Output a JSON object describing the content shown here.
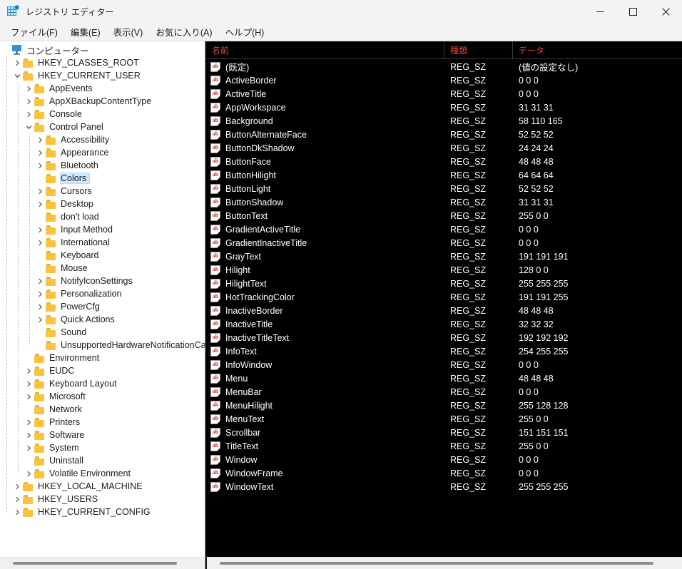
{
  "window": {
    "title": "レジストリ エディター",
    "app_icon": "registry-editor-icon",
    "controls": {
      "minimize": "minimize-icon",
      "maximize": "maximize-icon",
      "close": "close-icon"
    }
  },
  "menubar": {
    "items": [
      {
        "label": "ファイル(F)"
      },
      {
        "label": "編集(E)"
      },
      {
        "label": "表示(V)"
      },
      {
        "label": "お気に入り(A)"
      },
      {
        "label": "ヘルプ(H)"
      }
    ]
  },
  "tree": {
    "nodes": [
      {
        "label": "コンピューター",
        "depth": 0,
        "icon": "computer-icon",
        "expander": "none",
        "selected": false
      },
      {
        "label": "HKEY_CLASSES_ROOT",
        "depth": 1,
        "icon": "folder-icon",
        "expander": "collapsed",
        "selected": false
      },
      {
        "label": "HKEY_CURRENT_USER",
        "depth": 1,
        "icon": "folder-icon",
        "expander": "expanded",
        "selected": false
      },
      {
        "label": "AppEvents",
        "depth": 2,
        "icon": "folder-icon",
        "expander": "collapsed",
        "selected": false
      },
      {
        "label": "AppXBackupContentType",
        "depth": 2,
        "icon": "folder-icon",
        "expander": "collapsed",
        "selected": false
      },
      {
        "label": "Console",
        "depth": 2,
        "icon": "folder-icon",
        "expander": "collapsed",
        "selected": false
      },
      {
        "label": "Control Panel",
        "depth": 2,
        "icon": "folder-icon",
        "expander": "expanded",
        "selected": false
      },
      {
        "label": "Accessibility",
        "depth": 3,
        "icon": "folder-icon",
        "expander": "collapsed",
        "selected": false
      },
      {
        "label": "Appearance",
        "depth": 3,
        "icon": "folder-icon",
        "expander": "collapsed",
        "selected": false
      },
      {
        "label": "Bluetooth",
        "depth": 3,
        "icon": "folder-icon",
        "expander": "collapsed",
        "selected": false
      },
      {
        "label": "Colors",
        "depth": 3,
        "icon": "folder-icon",
        "expander": "none",
        "selected": true
      },
      {
        "label": "Cursors",
        "depth": 3,
        "icon": "folder-icon",
        "expander": "collapsed",
        "selected": false
      },
      {
        "label": "Desktop",
        "depth": 3,
        "icon": "folder-icon",
        "expander": "collapsed",
        "selected": false
      },
      {
        "label": "don't load",
        "depth": 3,
        "icon": "folder-icon",
        "expander": "none",
        "selected": false
      },
      {
        "label": "Input Method",
        "depth": 3,
        "icon": "folder-icon",
        "expander": "collapsed",
        "selected": false
      },
      {
        "label": "International",
        "depth": 3,
        "icon": "folder-icon",
        "expander": "collapsed",
        "selected": false
      },
      {
        "label": "Keyboard",
        "depth": 3,
        "icon": "folder-icon",
        "expander": "none",
        "selected": false
      },
      {
        "label": "Mouse",
        "depth": 3,
        "icon": "folder-icon",
        "expander": "none",
        "selected": false
      },
      {
        "label": "NotifyIconSettings",
        "depth": 3,
        "icon": "folder-icon",
        "expander": "collapsed",
        "selected": false
      },
      {
        "label": "Personalization",
        "depth": 3,
        "icon": "folder-icon",
        "expander": "collapsed",
        "selected": false
      },
      {
        "label": "PowerCfg",
        "depth": 3,
        "icon": "folder-icon",
        "expander": "collapsed",
        "selected": false
      },
      {
        "label": "Quick Actions",
        "depth": 3,
        "icon": "folder-icon",
        "expander": "collapsed",
        "selected": false
      },
      {
        "label": "Sound",
        "depth": 3,
        "icon": "folder-icon",
        "expander": "none",
        "selected": false
      },
      {
        "label": "UnsupportedHardwareNotificationCache",
        "depth": 3,
        "icon": "folder-icon",
        "expander": "none",
        "selected": false
      },
      {
        "label": "Environment",
        "depth": 2,
        "icon": "folder-icon",
        "expander": "none",
        "selected": false
      },
      {
        "label": "EUDC",
        "depth": 2,
        "icon": "folder-icon",
        "expander": "collapsed",
        "selected": false
      },
      {
        "label": "Keyboard Layout",
        "depth": 2,
        "icon": "folder-icon",
        "expander": "collapsed",
        "selected": false
      },
      {
        "label": "Microsoft",
        "depth": 2,
        "icon": "folder-icon",
        "expander": "collapsed",
        "selected": false
      },
      {
        "label": "Network",
        "depth": 2,
        "icon": "folder-icon",
        "expander": "none",
        "selected": false
      },
      {
        "label": "Printers",
        "depth": 2,
        "icon": "folder-icon",
        "expander": "collapsed",
        "selected": false
      },
      {
        "label": "Software",
        "depth": 2,
        "icon": "folder-icon",
        "expander": "collapsed",
        "selected": false
      },
      {
        "label": "System",
        "depth": 2,
        "icon": "folder-icon",
        "expander": "collapsed",
        "selected": false
      },
      {
        "label": "Uninstall",
        "depth": 2,
        "icon": "folder-icon",
        "expander": "none",
        "selected": false
      },
      {
        "label": "Volatile Environment",
        "depth": 2,
        "icon": "folder-icon",
        "expander": "collapsed",
        "selected": false
      },
      {
        "label": "HKEY_LOCAL_MACHINE",
        "depth": 1,
        "icon": "folder-icon",
        "expander": "collapsed",
        "selected": false
      },
      {
        "label": "HKEY_USERS",
        "depth": 1,
        "icon": "folder-icon",
        "expander": "collapsed",
        "selected": false
      },
      {
        "label": "HKEY_CURRENT_CONFIG",
        "depth": 1,
        "icon": "folder-icon",
        "expander": "collapsed",
        "selected": false
      }
    ]
  },
  "list": {
    "columns": [
      {
        "label": "名前"
      },
      {
        "label": "種類"
      },
      {
        "label": "データ"
      }
    ],
    "rows": [
      {
        "name": "(既定)",
        "type": "REG_SZ",
        "data": "(値の設定なし)"
      },
      {
        "name": "ActiveBorder",
        "type": "REG_SZ",
        "data": "0 0 0"
      },
      {
        "name": "ActiveTitle",
        "type": "REG_SZ",
        "data": "0 0 0"
      },
      {
        "name": "AppWorkspace",
        "type": "REG_SZ",
        "data": "31 31 31"
      },
      {
        "name": "Background",
        "type": "REG_SZ",
        "data": "58 110 165"
      },
      {
        "name": "ButtonAlternateFace",
        "type": "REG_SZ",
        "data": "52 52 52"
      },
      {
        "name": "ButtonDkShadow",
        "type": "REG_SZ",
        "data": "24 24 24"
      },
      {
        "name": "ButtonFace",
        "type": "REG_SZ",
        "data": "48 48 48"
      },
      {
        "name": "ButtonHilight",
        "type": "REG_SZ",
        "data": "64 64 64"
      },
      {
        "name": "ButtonLight",
        "type": "REG_SZ",
        "data": "52 52 52"
      },
      {
        "name": "ButtonShadow",
        "type": "REG_SZ",
        "data": "31 31 31"
      },
      {
        "name": "ButtonText",
        "type": "REG_SZ",
        "data": "255 0 0"
      },
      {
        "name": "GradientActiveTitle",
        "type": "REG_SZ",
        "data": "0 0 0"
      },
      {
        "name": "GradientInactiveTitle",
        "type": "REG_SZ",
        "data": "0 0 0"
      },
      {
        "name": "GrayText",
        "type": "REG_SZ",
        "data": "191 191 191"
      },
      {
        "name": "Hilight",
        "type": "REG_SZ",
        "data": "128 0 0"
      },
      {
        "name": "HilightText",
        "type": "REG_SZ",
        "data": "255 255 255"
      },
      {
        "name": "HotTrackingColor",
        "type": "REG_SZ",
        "data": "191 191 255"
      },
      {
        "name": "InactiveBorder",
        "type": "REG_SZ",
        "data": "48 48 48"
      },
      {
        "name": "InactiveTitle",
        "type": "REG_SZ",
        "data": "32 32 32"
      },
      {
        "name": "InactiveTitleText",
        "type": "REG_SZ",
        "data": "192 192 192"
      },
      {
        "name": "InfoText",
        "type": "REG_SZ",
        "data": "254 255 255"
      },
      {
        "name": "InfoWindow",
        "type": "REG_SZ",
        "data": "0 0 0"
      },
      {
        "name": "Menu",
        "type": "REG_SZ",
        "data": "48 48 48"
      },
      {
        "name": "MenuBar",
        "type": "REG_SZ",
        "data": "0 0 0"
      },
      {
        "name": "MenuHilight",
        "type": "REG_SZ",
        "data": "255 128 128"
      },
      {
        "name": "MenuText",
        "type": "REG_SZ",
        "data": "255 0 0"
      },
      {
        "name": "Scrollbar",
        "type": "REG_SZ",
        "data": "151 151 151"
      },
      {
        "name": "TitleText",
        "type": "REG_SZ",
        "data": "255 0 0"
      },
      {
        "name": "Window",
        "type": "REG_SZ",
        "data": "0 0 0"
      },
      {
        "name": "WindowFrame",
        "type": "REG_SZ",
        "data": "0 0 0"
      },
      {
        "name": "WindowText",
        "type": "REG_SZ",
        "data": "255 255 255"
      }
    ],
    "row_icon": "string-value-icon"
  },
  "colors": {
    "titlebar_bg": "#f3f3f3",
    "tree_bg": "#ffffff",
    "list_bg": "#000000",
    "list_text": "#ffffff",
    "header_text": "#e04a35",
    "selection": "#cde8ff",
    "folder": "#fbc23e"
  }
}
